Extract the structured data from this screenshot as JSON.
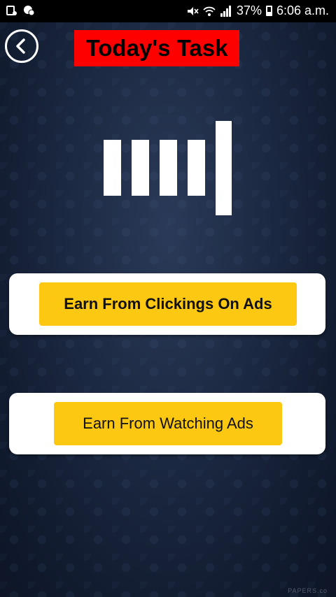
{
  "status_bar": {
    "battery_percent": "37%",
    "time": "6:06 a.m.",
    "icons": [
      "notification-icon",
      "chat-icon",
      "mute-icon",
      "wifi-icon",
      "signal-icon",
      "battery-icon"
    ]
  },
  "header": {
    "back_icon": "chevron-left-icon",
    "title": "Today's Task",
    "title_bg": "#ff0000"
  },
  "graphic": {
    "icon": "bars-icon"
  },
  "actions": {
    "clicking_label": "Earn From Clickings On Ads",
    "watching_label": "Earn From Watching Ads",
    "button_color": "#fdc812"
  },
  "watermark": "PAPERS.co"
}
